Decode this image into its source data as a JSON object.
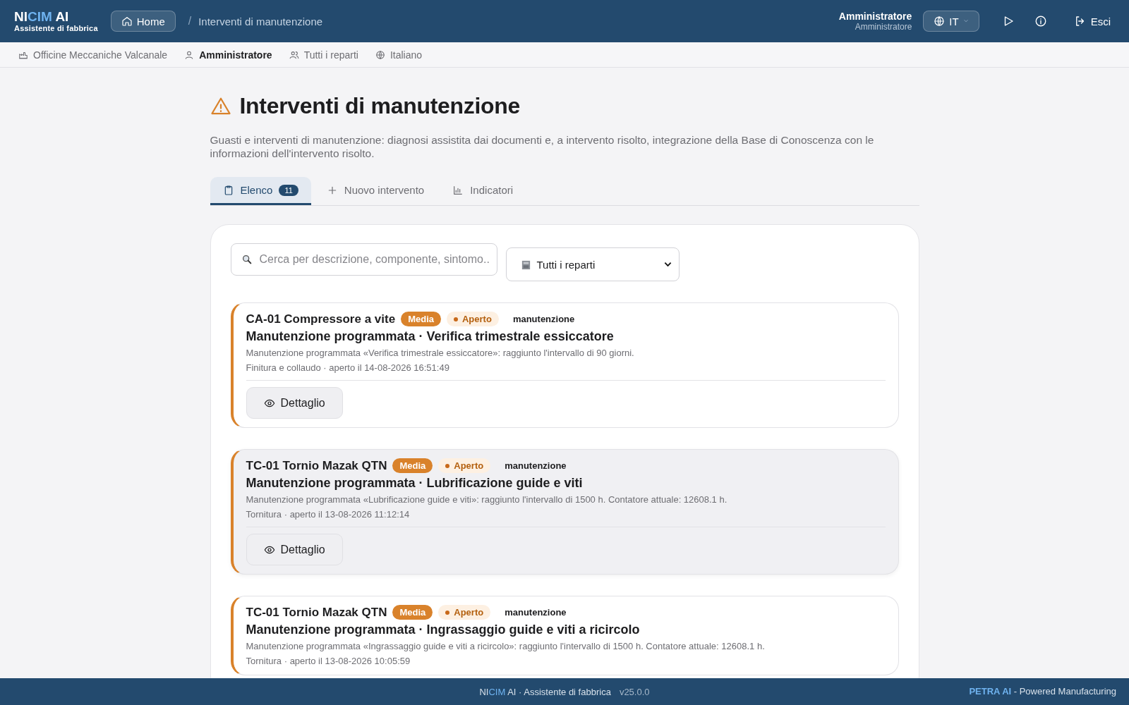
{
  "header": {
    "logo": [
      {
        "text": "NI",
        "accent": false
      },
      {
        "text": "CIM",
        "accent": true
      },
      {
        "text": " AI",
        "accent": false
      }
    ],
    "logo_subtitle": "Assistente di fabbrica",
    "home_button": "Home",
    "breadcrumb_separator": "/",
    "breadcrumb": "Interventi di manutenzione",
    "user_name": "Amministratore",
    "user_role": "Amministratore",
    "language": "IT",
    "logout": "Esci"
  },
  "context_bar": [
    {
      "kind": "factory",
      "label": "Officine Meccaniche Valcanale",
      "bold": false
    },
    {
      "kind": "user",
      "label": "Amministratore",
      "bold": true
    },
    {
      "kind": "users",
      "label": "Tutti i reparti",
      "bold": false
    },
    {
      "kind": "globe",
      "label": "Italiano",
      "bold": false
    }
  ],
  "page": {
    "title": "Interventi di manutenzione",
    "description": "Guasti e interventi di manutenzione: diagnosi assistita dai documenti e, a intervento risolto, integrazione della Base di Conoscenza con le informazioni dell'intervento risolto."
  },
  "tabs": [
    {
      "kind": "list",
      "label": "Elenco",
      "count": "11",
      "selected": true
    },
    {
      "kind": "new",
      "label": "Nuovo intervento",
      "selected": false
    },
    {
      "kind": "chart",
      "label": "Indicatori",
      "selected": false
    }
  ],
  "filters": {
    "search": {
      "placeholder": "Cerca per descrizione, componente, sintomo.."
    },
    "department": {
      "value": "Tutti i reparti"
    }
  },
  "interventions": [
    {
      "machine": "CA-01 Compressore a vite",
      "priority": "Media",
      "status": "Aperto",
      "type": "manutenzione",
      "title": "Manutenzione programmata · Verifica trimestrale essiccatore",
      "description": "Manutenzione programmata «Verifica trimestrale essiccatore»: raggiunto l'intervallo di 90 giorni.",
      "meta": "Finitura e collaudo · aperto il 14-08-2026 16:51:49",
      "action": "Dettaglio",
      "hovered": false
    },
    {
      "machine": "TC-01 Tornio Mazak QTN",
      "priority": "Media",
      "status": "Aperto",
      "type": "manutenzione",
      "title": "Manutenzione programmata · Lubrificazione guide e viti",
      "description": "Manutenzione programmata «Lubrificazione guide e viti»: raggiunto l'intervallo di 1500 h. Contatore attuale: 12608.1 h.",
      "meta": "Tornitura · aperto il 13-08-2026 11:12:14",
      "action": "Dettaglio",
      "hovered": true
    },
    {
      "machine": "TC-01 Tornio Mazak QTN",
      "priority": "Media",
      "status": "Aperto",
      "type": "manutenzione",
      "title": "Manutenzione programmata · Ingrassaggio guide e viti a ricircolo",
      "description": "Manutenzione programmata «Ingrassaggio guide e viti a ricircolo»: raggiunto l'intervallo di 1500 h. Contatore attuale: 12608.1 h.",
      "meta": "Tornitura · aperto il 13-08-2026 10:05:59",
      "hovered": false
    }
  ],
  "footer": {
    "brand": [
      {
        "text": "NI",
        "accent": false
      },
      {
        "text": "CIM",
        "accent": true
      },
      {
        "text": " AI · Assistente di fabbrica",
        "accent": false
      }
    ],
    "version": "v25.0.0",
    "powered_brand": "PETRA AI",
    "powered_text": " - Powered Manufacturing"
  }
}
